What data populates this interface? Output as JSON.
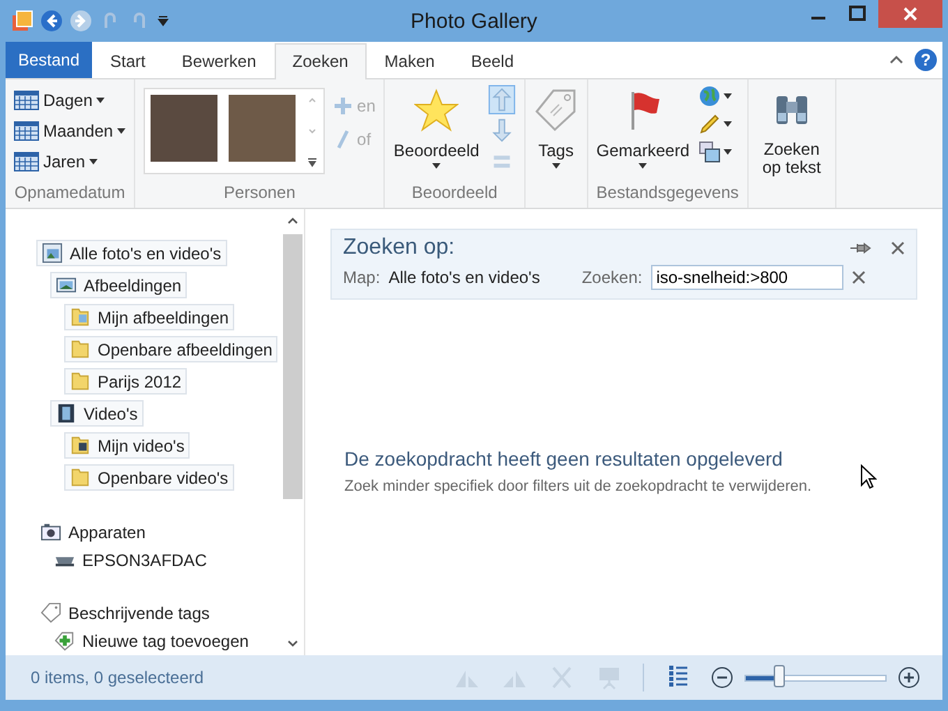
{
  "window": {
    "title": "Photo Gallery"
  },
  "help_button": "?",
  "ribbon_tabs": [
    {
      "label": "Bestand",
      "kind": "file",
      "selected": false
    },
    {
      "label": "Start",
      "kind": "tab",
      "selected": false
    },
    {
      "label": "Bewerken",
      "kind": "tab",
      "selected": false
    },
    {
      "label": "Zoeken",
      "kind": "tab",
      "selected": true
    },
    {
      "label": "Maken",
      "kind": "tab",
      "selected": false
    },
    {
      "label": "Beeld",
      "kind": "tab",
      "selected": false
    }
  ],
  "ribbon_groups": [
    {
      "kind": "date",
      "label": "Opnamedatum",
      "items": [
        "Dagen",
        "Maanden",
        "Jaren"
      ]
    },
    {
      "kind": "people",
      "label": "Personen",
      "operators": [
        "en",
        "of"
      ]
    },
    {
      "kind": "rating",
      "label": "Beoordeeld",
      "button": "Beoordeeld"
    },
    {
      "kind": "tags",
      "button": "Tags"
    },
    {
      "kind": "flag",
      "label": "Bestandsgegevens",
      "button": "Gemarkeerd"
    },
    {
      "kind": "textsearch",
      "button": "Zoeken op tekst"
    }
  ],
  "sidebar": [
    {
      "kind": "library",
      "items": [
        {
          "label": "Alle foto's en video's",
          "kind": "library",
          "children": [
            {
              "label": "Afbeeldingen",
              "kind": "pictures",
              "children": [
                {
                  "label": "Mijn afbeeldingen",
                  "kind": "folder-pic"
                },
                {
                  "label": "Openbare afbeeldingen",
                  "kind": "folder"
                },
                {
                  "label": "Parijs 2012",
                  "kind": "folder"
                }
              ]
            },
            {
              "label": "Video's",
              "kind": "video",
              "children": [
                {
                  "label": "Mijn video's",
                  "kind": "folder-video"
                },
                {
                  "label": "Openbare video's",
                  "kind": "folder"
                }
              ]
            }
          ]
        }
      ]
    },
    {
      "kind": "devices",
      "label": "Apparaten",
      "items": [
        {
          "label": "EPSON3AFDAC",
          "kind": "scanner"
        }
      ]
    },
    {
      "kind": "tags",
      "label": "Beschrijvende tags",
      "items": [
        {
          "label": "Nieuwe tag toevoegen",
          "kind": "tag-add"
        }
      ]
    }
  ],
  "search_panel": {
    "title": "Zoeken op:",
    "map_label": "Map:",
    "map_value": "Alle foto's en video's",
    "search_label": "Zoeken:",
    "search_value": "iso-snelheid:>800"
  },
  "empty_message": {
    "title": "De zoekopdracht heeft geen resultaten opgeleverd",
    "hint": "Zoek minder specifiek door filters uit de zoekopdracht te verwijderen."
  },
  "status_bar": {
    "text": "0 items, 0 geselecteerd",
    "zoom": {
      "level": 0.24
    }
  }
}
